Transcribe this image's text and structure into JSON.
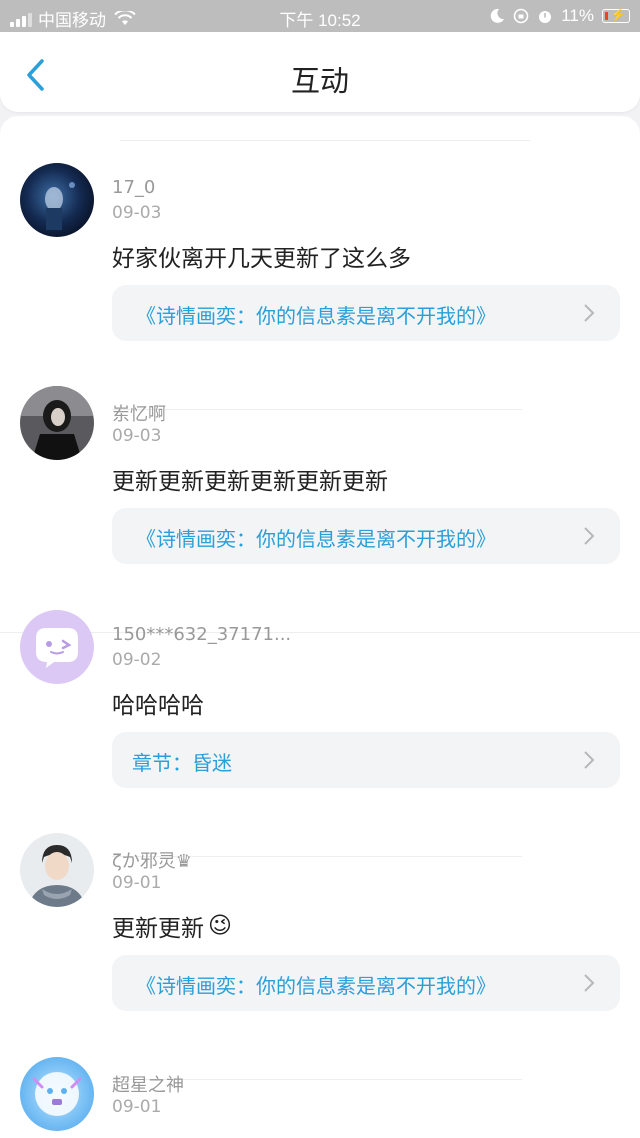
{
  "status_bar": {
    "carrier": "中国移动",
    "time": "下午 10:52",
    "battery": "11%"
  },
  "header": {
    "title": "互动"
  },
  "comments": [
    {
      "username": "17_0",
      "date": "09-03",
      "text": "好家伙离开几天更新了这么多",
      "link": "《诗情画奕：你的信息素是离不开我的》"
    },
    {
      "username": "岽忆啊",
      "date": "09-03",
      "text": "更新更新更新更新更新更新",
      "link": "《诗情画奕：你的信息素是离不开我的》"
    },
    {
      "username": "150***632_37171...",
      "date": "09-02",
      "text": "哈哈哈哈",
      "link": "章节：昏迷"
    },
    {
      "username": "ζか邪灵♛",
      "date": "09-01",
      "text": "更新更新",
      "emoji": "😉",
      "link": "《诗情画奕：你的信息素是离不开我的》"
    },
    {
      "username": "超星之神",
      "date": "09-01",
      "text": ""
    }
  ],
  "colors": {
    "accent": "#2a9fd8",
    "status_bar_bg": "#bdbdbd",
    "page_bg": "#f2f2f4"
  }
}
